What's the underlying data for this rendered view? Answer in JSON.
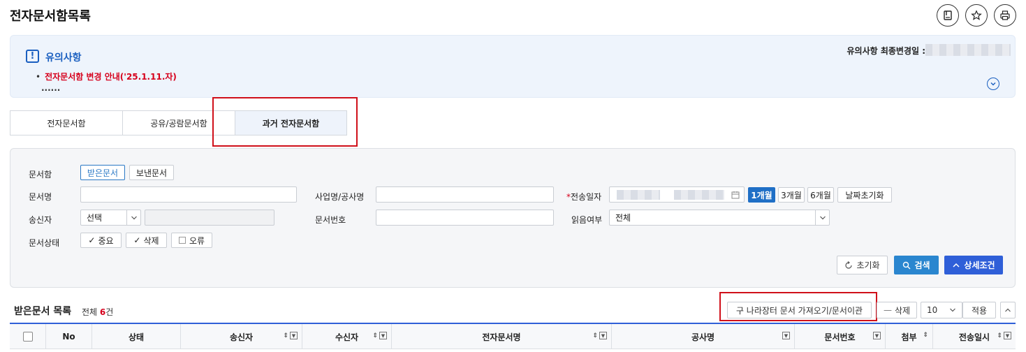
{
  "page": {
    "title": "전자문서함목록"
  },
  "notice": {
    "title": "유의사항",
    "last_changed_label": "유의사항 최종변경일 :",
    "items": [
      "전자문서함 변경 안내('25.1.11.자)"
    ],
    "more": "......"
  },
  "tabs": [
    {
      "label": "전자문서함",
      "active": false
    },
    {
      "label": "공유/공람문서함",
      "active": false
    },
    {
      "label": "과거 전자문서함",
      "active": true
    }
  ],
  "search": {
    "docbox_label": "문서함",
    "received_label": "받은문서",
    "sent_label": "보낸문서",
    "docname_label": "문서명",
    "project_label": "사업명/공사명",
    "send_date_label": "전송일자",
    "period_1m": "1개월",
    "period_3m": "3개월",
    "period_6m": "6개월",
    "date_reset": "날짜초기화",
    "sender_label": "송신자",
    "sender_select": "선택",
    "docno_label": "문서번호",
    "read_label": "읽음여부",
    "read_select": "전체",
    "status_label": "문서상태",
    "status_important": "중요",
    "status_deleted": "삭제",
    "status_error": "오류",
    "reset_button": "초기화",
    "search_button": "검색",
    "detail_button": "상세조건"
  },
  "list": {
    "title": "받은문서 목록",
    "total_prefix": "전체",
    "total_count": "6",
    "total_suffix": "건",
    "import_button": "구 나라장터 문서 가져오기/문서이관",
    "delete_button": "삭제",
    "page_size": "10",
    "apply_button": "적용"
  },
  "table": {
    "columns": [
      "No",
      "상태",
      "송신자",
      "수신자",
      "전자문서명",
      "공사명",
      "문서번호",
      "첨부",
      "전송일시"
    ]
  },
  "colors": {
    "accent": "#1f6fc6",
    "highlight": "#d0101a",
    "notice_bg": "#eef4fc"
  }
}
